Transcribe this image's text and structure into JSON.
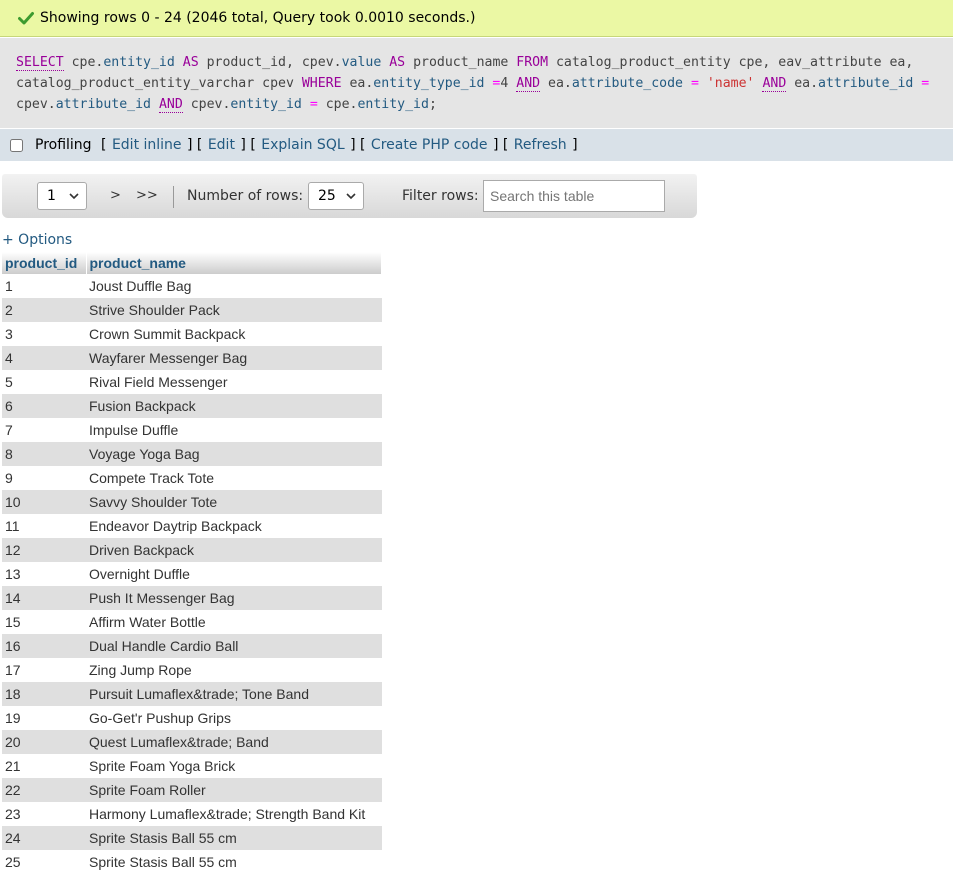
{
  "success": {
    "message": "Showing rows 0 - 24 (2046 total, Query took 0.0010 seconds.)",
    "icon": "checkmark-icon"
  },
  "sql": {
    "line1": [
      {
        "t": "SELECT",
        "c": "kwu"
      },
      {
        "t": " cpe.",
        "c": ""
      },
      {
        "t": "entity_id",
        "c": "col"
      },
      {
        "t": " ",
        "c": ""
      },
      {
        "t": "AS",
        "c": "kw"
      },
      {
        "t": " product_id, cpev.",
        "c": ""
      },
      {
        "t": "value",
        "c": "col"
      },
      {
        "t": " ",
        "c": ""
      },
      {
        "t": "AS",
        "c": "kw"
      },
      {
        "t": " product_name ",
        "c": ""
      },
      {
        "t": "FROM",
        "c": "kw"
      },
      {
        "t": " catalog_product_entity cpe, eav_attribute ea,",
        "c": ""
      }
    ],
    "line2": [
      {
        "t": "catalog_product_entity_varchar cpev ",
        "c": ""
      },
      {
        "t": "WHERE",
        "c": "kw"
      },
      {
        "t": " ea.",
        "c": ""
      },
      {
        "t": "entity_type_id",
        "c": "col"
      },
      {
        "t": " ",
        "c": ""
      },
      {
        "t": "=",
        "c": "op"
      },
      {
        "t": "4 ",
        "c": ""
      },
      {
        "t": "AND",
        "c": "kwu"
      },
      {
        "t": " ea.",
        "c": ""
      },
      {
        "t": "attribute_code",
        "c": "col"
      },
      {
        "t": " ",
        "c": ""
      },
      {
        "t": "=",
        "c": "op"
      },
      {
        "t": " ",
        "c": ""
      },
      {
        "t": "'name'",
        "c": "str"
      },
      {
        "t": " ",
        "c": ""
      },
      {
        "t": "AND",
        "c": "kwu"
      },
      {
        "t": " ea.",
        "c": ""
      },
      {
        "t": "attribute_id",
        "c": "col"
      },
      {
        "t": " ",
        "c": ""
      },
      {
        "t": "=",
        "c": "op"
      }
    ],
    "line3": [
      {
        "t": "cpev.",
        "c": ""
      },
      {
        "t": "attribute_id",
        "c": "col"
      },
      {
        "t": " ",
        "c": ""
      },
      {
        "t": "AND",
        "c": "kwu"
      },
      {
        "t": " cpev.",
        "c": ""
      },
      {
        "t": "entity_id",
        "c": "col"
      },
      {
        "t": " ",
        "c": ""
      },
      {
        "t": "=",
        "c": "op"
      },
      {
        "t": " cpe.",
        "c": ""
      },
      {
        "t": "entity_id",
        "c": "col"
      },
      {
        "t": ";",
        "c": ""
      }
    ]
  },
  "profiling": {
    "label": "Profiling",
    "links": [
      "Edit inline",
      "Edit",
      "Explain SQL",
      "Create PHP code",
      "Refresh"
    ]
  },
  "nav": {
    "page_value": "1",
    "next_label": ">",
    "last_label": ">>",
    "rows_label": "Number of rows:",
    "rows_value": "25",
    "filter_label": "Filter rows:",
    "search_placeholder": "Search this table"
  },
  "options_label": "+ Options",
  "table": {
    "headers": [
      "product_id",
      "product_name"
    ],
    "rows": [
      [
        "1",
        "Joust Duffle Bag"
      ],
      [
        "2",
        "Strive Shoulder Pack"
      ],
      [
        "3",
        "Crown Summit Backpack"
      ],
      [
        "4",
        "Wayfarer Messenger Bag"
      ],
      [
        "5",
        "Rival Field Messenger"
      ],
      [
        "6",
        "Fusion Backpack"
      ],
      [
        "7",
        "Impulse Duffle"
      ],
      [
        "8",
        "Voyage Yoga Bag"
      ],
      [
        "9",
        "Compete Track Tote"
      ],
      [
        "10",
        "Savvy Shoulder Tote"
      ],
      [
        "11",
        "Endeavor Daytrip Backpack"
      ],
      [
        "12",
        "Driven Backpack"
      ],
      [
        "13",
        "Overnight Duffle"
      ],
      [
        "14",
        "Push It Messenger Bag"
      ],
      [
        "15",
        "Affirm Water Bottle"
      ],
      [
        "16",
        "Dual Handle Cardio Ball"
      ],
      [
        "17",
        "Zing Jump Rope"
      ],
      [
        "18",
        "Pursuit Lumaflex&trade; Tone Band"
      ],
      [
        "19",
        "Go-Get'r Pushup Grips"
      ],
      [
        "20",
        "Quest Lumaflex&trade; Band"
      ],
      [
        "21",
        "Sprite Foam Yoga Brick"
      ],
      [
        "22",
        "Sprite Foam Roller"
      ],
      [
        "23",
        "Harmony Lumaflex&trade; Strength Band Kit"
      ],
      [
        "24",
        "Sprite Stasis Ball 55 cm"
      ],
      [
        "25",
        "Sprite Stasis Ball 55 cm"
      ]
    ]
  }
}
